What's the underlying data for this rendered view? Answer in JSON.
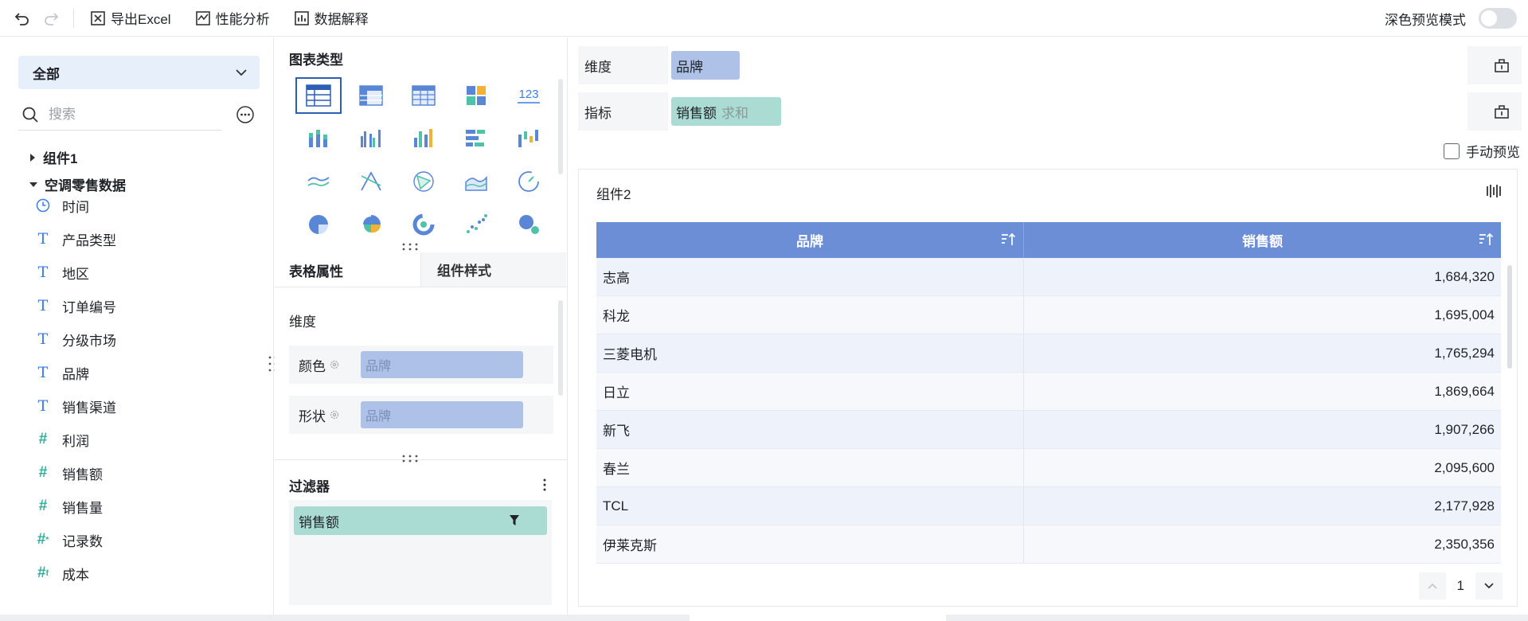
{
  "toolbar": {
    "export_label": "导出Excel",
    "perf_label": "性能分析",
    "explain_label": "数据解释",
    "dark_preview_label": "深色预览模式"
  },
  "left": {
    "dropdown_value": "全部",
    "search_placeholder": "搜索",
    "group1": "组件1",
    "group2": "空调零售数据",
    "fields": [
      {
        "label": "时间",
        "icon": "clock-icon"
      },
      {
        "label": "产品类型",
        "icon": "text-type-icon"
      },
      {
        "label": "地区",
        "icon": "text-type-icon"
      },
      {
        "label": "订单编号",
        "icon": "text-type-icon"
      },
      {
        "label": "分级市场",
        "icon": "text-type-icon"
      },
      {
        "label": "品牌",
        "icon": "text-type-icon"
      },
      {
        "label": "销售渠道",
        "icon": "text-type-icon"
      },
      {
        "label": "利润",
        "icon": "number-type-icon"
      },
      {
        "label": "销售额",
        "icon": "number-type-icon"
      },
      {
        "label": "销售量",
        "icon": "number-type-icon"
      },
      {
        "label": "记录数",
        "icon": "record-count-icon"
      },
      {
        "label": "成本",
        "icon": "calc-number-icon"
      }
    ]
  },
  "middle": {
    "chart_types_title": "图表类型",
    "tab_active": "表格属性",
    "tab_inactive": "组件样式",
    "dimension_label": "维度",
    "color_label": "颜色",
    "color_value": "品牌",
    "shape_label": "形状",
    "shape_value": "品牌",
    "filter_title": "过滤器",
    "filter_value": "销售额",
    "number_tile": "123"
  },
  "right": {
    "dimension_label": "维度",
    "dimension_chip": "品牌",
    "metric_label": "指标",
    "metric_chip": "销售额",
    "metric_agg": "求和",
    "manual_preview": "手动预览",
    "widget_title": "组件2",
    "table": {
      "headers": [
        "品牌",
        "销售额"
      ],
      "rows": [
        [
          "志高",
          "1,684,320"
        ],
        [
          "科龙",
          "1,695,004"
        ],
        [
          "三菱电机",
          "1,765,294"
        ],
        [
          "日立",
          "1,869,664"
        ],
        [
          "新飞",
          "1,907,266"
        ],
        [
          "春兰",
          "2,095,600"
        ],
        [
          "TCL",
          "2,177,928"
        ],
        [
          "伊莱克斯",
          "2,350,356"
        ]
      ]
    },
    "page_number": "1"
  },
  "colors": {
    "accent": "#6b8ed6",
    "dimension_chip": "#aec2e8",
    "metric_chip": "#abdcd4",
    "dropdown_bg": "#e7effb"
  }
}
